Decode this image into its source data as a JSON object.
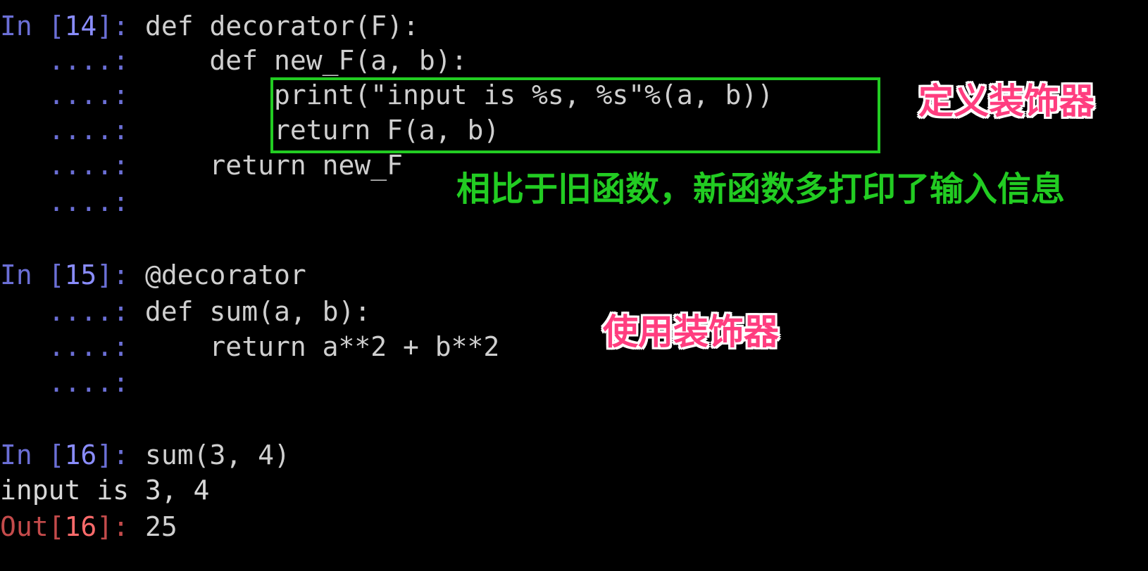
{
  "cells": [
    {
      "in_prompt": "In [",
      "number": "14",
      "in_suffix": "]:",
      "lines": [
        "def decorator(F):",
        "    def new_F(a, b):",
        "        print(\"input is %s, %s\"%(a, b))",
        "        return F(a, b)",
        "    return new_F",
        ""
      ]
    },
    {
      "in_prompt": "In [",
      "number": "15",
      "in_suffix": "]:",
      "lines": [
        "@decorator",
        "def sum(a, b):",
        "    return a**2 + b**2",
        ""
      ]
    },
    {
      "in_prompt": "In [",
      "number": "16",
      "in_suffix": "]:",
      "lines": [
        "sum(3, 4)"
      ],
      "stdout": "input is 3, 4",
      "out_prompt": "Out[",
      "out_number": "16",
      "out_suffix": "]:",
      "result": "25"
    }
  ],
  "continuation_prompt": "   ....:",
  "annotations": {
    "define_decorator": "定义装饰器",
    "explanation": "相比于旧函数，新函数多打印了输入信息",
    "use_decorator": "使用装饰器"
  },
  "colors": {
    "background": "#000000",
    "prompt": "#6b6fd6",
    "out_prompt": "#c44b4b",
    "code": "#cfcfcf",
    "highlight_box": "#22cc22",
    "annotation_pink": "#ff3d7f",
    "annotation_green": "#22cc22"
  }
}
